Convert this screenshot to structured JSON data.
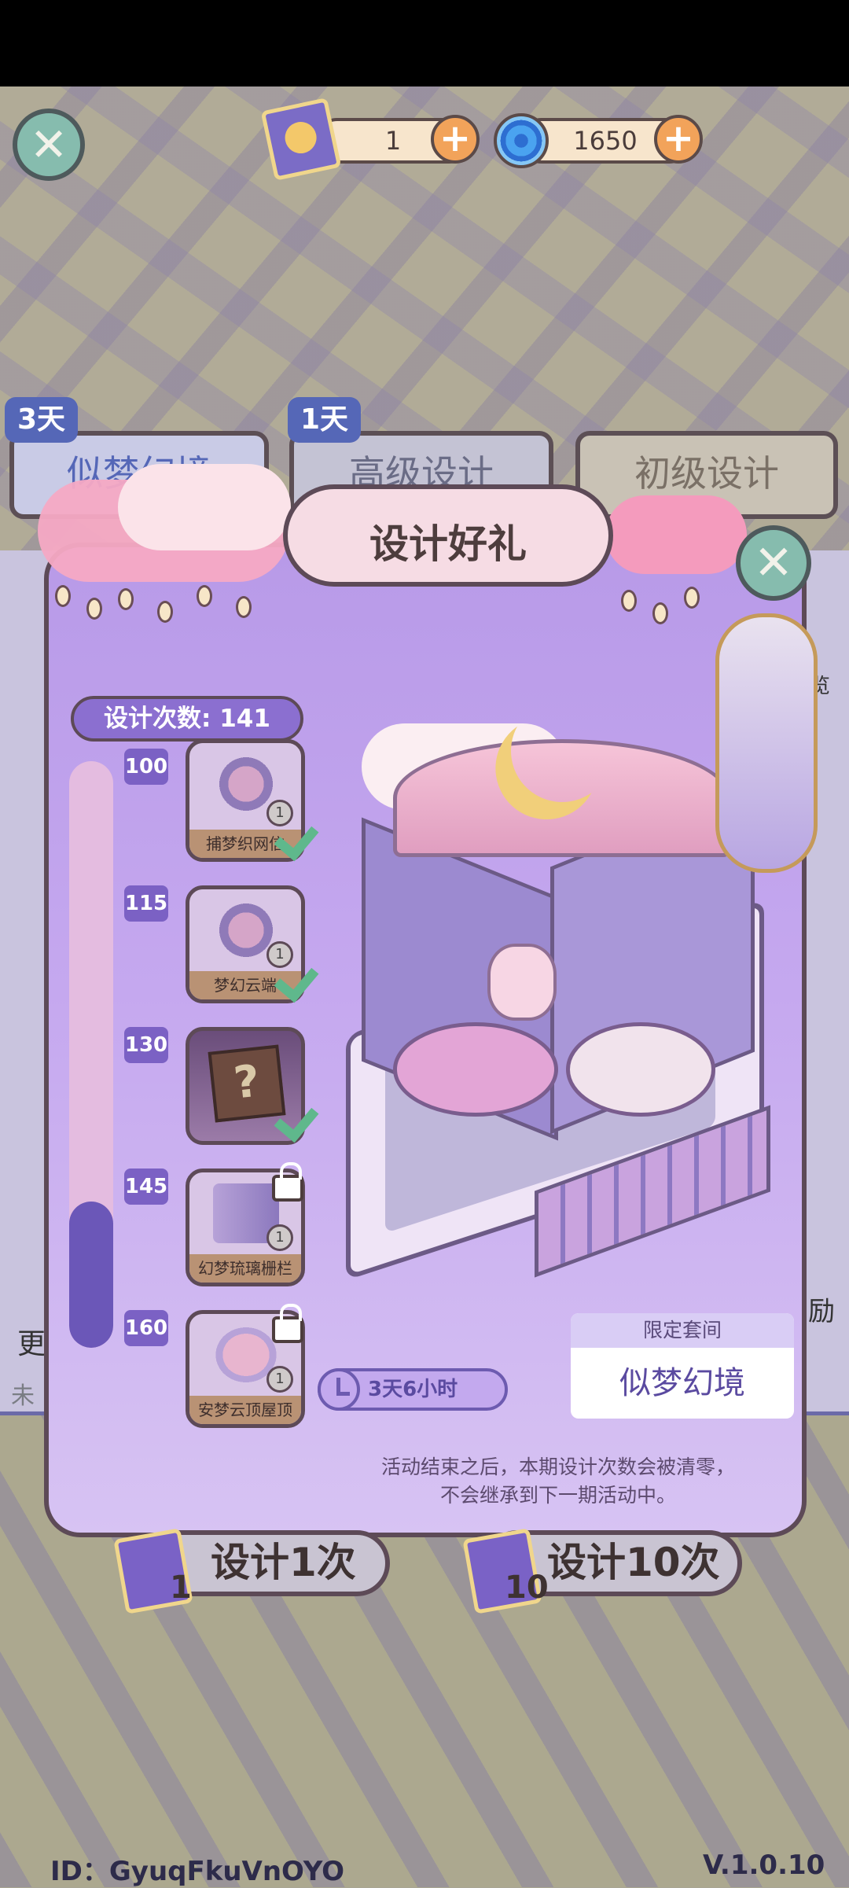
{
  "header": {
    "tickets": "1",
    "currency": "1650"
  },
  "tabs": [
    {
      "label": "似梦幻境",
      "days": "3天"
    },
    {
      "label": "高级设计",
      "days": "1天"
    },
    {
      "label": "初级设计",
      "days": ""
    }
  ],
  "modal": {
    "title": "设计好礼",
    "count_label": "设计次数: 141",
    "progress_fraction": 0.25,
    "milestones": [
      {
        "value": "100",
        "name": "捕梦织网信",
        "qty": "1",
        "status": "claimed"
      },
      {
        "value": "115",
        "name": "梦幻云端",
        "qty": "1",
        "status": "claimed"
      },
      {
        "value": "130",
        "name": "",
        "qty": "",
        "status": "claimed-mystery"
      },
      {
        "value": "145",
        "name": "幻梦琉璃栅栏",
        "qty": "1",
        "status": "locked"
      },
      {
        "value": "160",
        "name": "安梦云顶屋顶",
        "qty": "1",
        "status": "locked"
      }
    ],
    "timer": "3天6小时",
    "suite_header": "限定套间",
    "suite_name": "似梦幻境",
    "note_line1": "活动结束之后，本期设计次数会被清零，",
    "note_line2": "不会继承到下一期活动中。"
  },
  "buttons": {
    "design_once": "设计1次",
    "design_once_cost": "1",
    "design_ten": "设计10次",
    "design_ten_cost": "10"
  },
  "background": {
    "left_partial": "更",
    "left_partial2": "未",
    "right_partial": "励",
    "right_partial2": "览"
  },
  "footer": {
    "id": "ID：GyuqFkuVnOYO",
    "version": "V.1.0.10"
  },
  "colors": {
    "modal_top": "#b89ae8",
    "progress_fill": "#6b57b8",
    "check": "#5fb88c",
    "close_button": "#86bcae"
  }
}
